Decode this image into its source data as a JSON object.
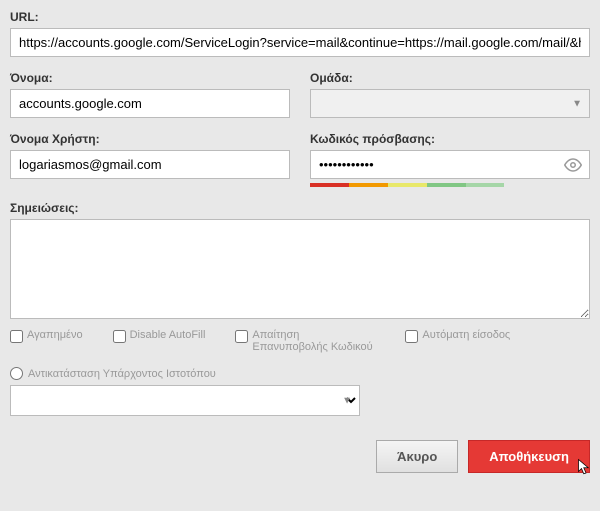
{
  "labels": {
    "url": "URL:",
    "name": "Όνομα:",
    "group": "Ομάδα:",
    "username": "Όνομα Χρήστη:",
    "password": "Κωδικός πρόσβασης:",
    "notes": "Σημειώσεις:"
  },
  "values": {
    "url": "https://accounts.google.com/ServiceLogin?service=mail&continue=https://mail.google.com/mail/&hl=e",
    "name": "accounts.google.com",
    "group": "",
    "username": "logariasmos@gmail.com",
    "password": "••••••••••••",
    "notes": ""
  },
  "checkboxes": {
    "favorite": "Αγαπημένο",
    "disable_autofill": "Disable AutoFill",
    "require_reprompt": "Απαίτηση Επανυποβολής Κωδικού",
    "autologin": "Αυτόματη είσοδος"
  },
  "radio": {
    "replace_existing": "Αντικατάσταση Υπάρχοντος Ιστοτόπου"
  },
  "buttons": {
    "cancel": "Άκυρο",
    "save": "Αποθήκευση"
  }
}
